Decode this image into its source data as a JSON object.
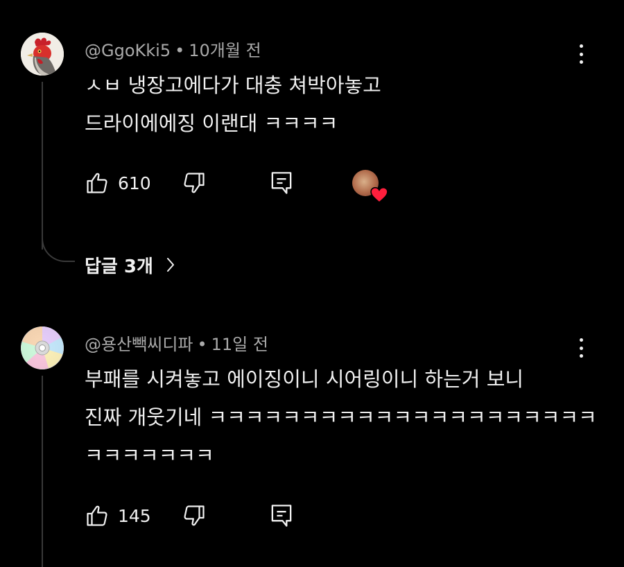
{
  "comments": [
    {
      "author": "@GgoKki5",
      "separator": "•",
      "time": "10개월 전",
      "lines": [
        "ㅅㅂ 냉장고에다가 대충 쳐박아놓고",
        "드라이에에징 이랜대 ㅋㅋㅋㅋ"
      ],
      "likes": "610",
      "avatar_icon": "rooster-avatar-icon",
      "creator_heart": true,
      "replies_label": "답글 3개"
    },
    {
      "author": "@용산빽씨디파",
      "separator": "•",
      "time": "11일 전",
      "lines": [
        "부패를 시켜놓고 에이징이니 시어링이니 하는거 보니",
        "진짜 개웃기네 ㅋㅋㅋㅋㅋㅋㅋㅋㅋㅋㅋㅋㅋㅋㅋㅋㅋㅋㅋㅋㅋ",
        "ㅋㅋㅋㅋㅋㅋㅋ"
      ],
      "likes": "145",
      "avatar_icon": "cd-disc-avatar-icon",
      "creator_heart": false
    }
  ],
  "colors": {
    "background": "#000000",
    "text": "#f1f1f1",
    "meta": "#aaaaaa",
    "thread": "#3a3a3a",
    "heart": "#ff1f3d"
  }
}
